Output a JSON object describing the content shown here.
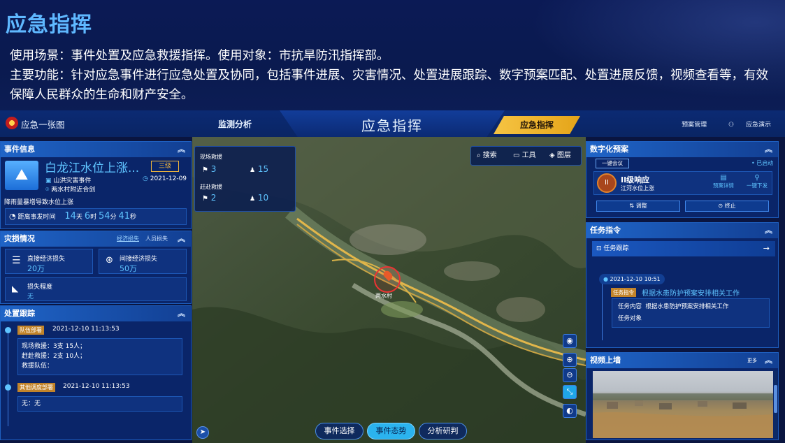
{
  "slide": {
    "title": "应急指挥",
    "desc_line1": "使用场景：事件处置及应急救援指挥。使用对象：市抗旱防汛指挥部。",
    "desc_line2": "主要功能：针对应急事件进行应急处置及协同，包括事件进展、灾害情况、处置进展跟踪、数字预案匹配、处置进展反馈，视频查看等，有效保障人民群众的生命和财产安全。"
  },
  "topbar": {
    "app_name": "应急一张图",
    "nav_left": "监测分析",
    "center_title": "应急指挥",
    "nav_right": "应急指挥",
    "link_plans": "预案管理",
    "user": "应急演示"
  },
  "event": {
    "header": "事件信息",
    "title": "白龙江水位上涨...",
    "level": "三级",
    "type": "山洪灾害事件",
    "date": "2021-12-09",
    "location": "两水村附近合剑",
    "desc": "降雨量暴增导致水位上涨",
    "elapsed_label": "距离事发时间",
    "days": "14",
    "days_unit": "天",
    "hours": "6",
    "hours_unit": "时",
    "minutes": "54",
    "minutes_unit": "分",
    "seconds": "41",
    "seconds_unit": "秒"
  },
  "rescue": {
    "header": "灾损情况",
    "tab_economic": "经济损失",
    "tab_people": "人员损失",
    "direct_label": "直接经济损失",
    "direct_value": "20万",
    "indirect_label": "间接经济损失",
    "indirect_value": "50万",
    "degree_label": "损失程度",
    "degree_value": "无"
  },
  "tracking": {
    "header": "处置跟踪",
    "item1_tag": "队伍部署",
    "item1_time": "2021-12-10 11:13:53",
    "item1_lines": [
      "现场救援：3支 15人；",
      "赶赴救援：2支 10人；",
      "救援队伍："
    ],
    "item2_tag": "其他调度部署",
    "item2_time": "2021-12-10 11:13:53",
    "item2_line": "无：无"
  },
  "map_overlay": {
    "onsite_label": "现场救援",
    "onsite_teams": "3",
    "onsite_people": "15",
    "enroute_label": "赶赴救援",
    "enroute_teams": "2",
    "enroute_people": "10",
    "search": "搜索",
    "tools": "工具",
    "layers": "图层",
    "place_label": "两水村",
    "btn_select": "事件选择",
    "btn_status": "事件态势",
    "btn_analysis": "分析研判"
  },
  "plan": {
    "header": "数字化预案",
    "meeting_btn": "一键会议",
    "status": "已启动",
    "level_title": "II级响应",
    "level_sub": "江河水位上涨",
    "plan_detail": "预案详情",
    "one_click": "一键下发",
    "adjust": "调整",
    "stop": "终止"
  },
  "tasks": {
    "header": "任务指令",
    "tab": "任务跟踪",
    "time": "2021-12-10 10:51",
    "tag": "任务指令",
    "title": "根据水患防护预案安排相关工作",
    "content_label": "任务内容",
    "content_value": "根据水患防护预案安排相关工作",
    "target_label": "任务对象"
  },
  "video": {
    "header": "视频上墙",
    "more": "更多"
  },
  "colors": {
    "accent": "#1f64c7",
    "gold": "#f6c443",
    "value": "#5fc4ff"
  }
}
